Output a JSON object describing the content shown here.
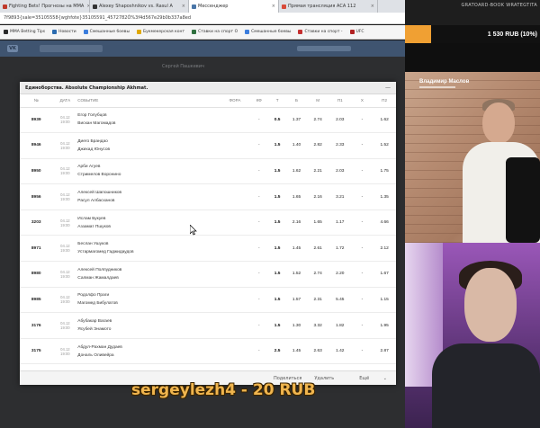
{
  "browser": {
    "tabs": [
      {
        "title": "Fighting Bets! Прогнозы на ММА",
        "color": "#c0392b",
        "active": false
      },
      {
        "title": "Alexey Shaposhnikov vs. Rasul A",
        "color": "#333333",
        "active": false
      },
      {
        "title": "Мессенджер",
        "color": "#4a76a8",
        "active": true
      },
      {
        "title": "Прямая трансляция ACA 112",
        "color": "#d84a3a",
        "active": false
      }
    ],
    "url": "7f9893{sale=35105558{wghfote}35105591_4572782Ó%3f4d567e29b0b337a8ed",
    "bookmarks": [
      {
        "label": "MMA Betting Tips",
        "color": "#2a2a2a"
      },
      {
        "label": "Новости",
        "color": "#2b6cb0"
      },
      {
        "label": "Смешанные боевы",
        "color": "#3b7ddd"
      },
      {
        "label": "Букмекерская конт",
        "color": "#e0a800"
      },
      {
        "label": "Ставки на спорт О",
        "color": "#2f6f3e"
      },
      {
        "label": "Смешанные боевы",
        "color": "#3b7ddd"
      },
      {
        "label": "Ставки на спорт -",
        "color": "#c53030"
      },
      {
        "label": "UFC",
        "color": "#b22222"
      }
    ]
  },
  "vk": {
    "logo": "VK",
    "page_strip": "Сергей Пашкевич"
  },
  "modal": {
    "title": "Единоборства. Absolute Championship Akhmat.",
    "columns": [
      "№",
      "ДАТА",
      "СОБЫТИЕ",
      "ФОРА",
      "КФ",
      "Т",
      "Б",
      "М",
      "П1",
      "Х",
      "П2"
    ],
    "rows": [
      {
        "num": "8939",
        "date": [
          "04.12",
          "19:00"
        ],
        "event": [
          "Егор Голубцов",
          "Вискан Магомадов"
        ],
        "fora": "",
        "kf": "-",
        "t": "0.5",
        "b": "1.37",
        "m": "2.74",
        "p1": "2.03",
        "x": "-",
        "p2": "1.62"
      },
      {
        "num": "8946",
        "date": [
          "04.12",
          "19:00"
        ],
        "event": [
          "Диего Брандао",
          "Джихад Юнусов"
        ],
        "fora": "",
        "kf": "-",
        "t": "1.5",
        "b": "1.40",
        "m": "2.82",
        "p1": "2.33",
        "x": "-",
        "p2": "1.52"
      },
      {
        "num": "8950",
        "date": [
          "04.12",
          "19:00"
        ],
        "event": [
          "Арби Агуев",
          "Стримелов Воронино"
        ],
        "fora": "",
        "kf": "-",
        "t": "1.5",
        "b": "1.62",
        "m": "2.21",
        "p1": "2.03",
        "x": "-",
        "p2": "1.75"
      },
      {
        "num": "8956",
        "date": [
          "04.12",
          "19:00"
        ],
        "event": [
          "Алексей Шапошников",
          "Расул Албасханов"
        ],
        "fora": "",
        "kf": "-",
        "t": "1.5",
        "b": "1.65",
        "m": "2.16",
        "p1": "3.21",
        "x": "-",
        "p2": "1.35"
      },
      {
        "num": "3203",
        "date": [
          "04.12",
          "19:00"
        ],
        "event": [
          "Ислам Букуев",
          "Аззамат Пшуков"
        ],
        "fora": "",
        "kf": "-",
        "t": "1.5",
        "b": "2.16",
        "m": "1.65",
        "p1": "1.17",
        "x": "-",
        "p2": "4.66"
      },
      {
        "num": "8971",
        "date": [
          "04.12",
          "19:00"
        ],
        "event": [
          "Беслан Ушуков",
          "Устармагомед Гаджидаудов"
        ],
        "fora": "",
        "kf": "-",
        "t": "1.5",
        "b": "1.45",
        "m": "2.61",
        "p1": "1.72",
        "x": "-",
        "p2": "2.12"
      },
      {
        "num": "8980",
        "date": [
          "04.12",
          "19:00"
        ],
        "event": [
          "Алексей Полпудников",
          "Салман Жамалдаев"
        ],
        "fora": "",
        "kf": "-",
        "t": "1.5",
        "b": "1.52",
        "m": "2.74",
        "p1": "2.20",
        "x": "-",
        "p2": "1.67"
      },
      {
        "num": "8985",
        "date": [
          "04.12",
          "19:00"
        ],
        "event": [
          "Родолфо Праги",
          "Магомед Бибулатов"
        ],
        "fora": "",
        "kf": "-",
        "t": "1.5",
        "b": "1.57",
        "m": "2.31",
        "p1": "5.45",
        "x": "-",
        "p2": "1.15"
      },
      {
        "num": "3176",
        "date": [
          "04.12",
          "19:00"
        ],
        "event": [
          "Абубакар Вагаев",
          "Ясубей Энамото"
        ],
        "fora": "",
        "kf": "-",
        "t": "1.5",
        "b": "1.30",
        "m": "3.32",
        "p1": "1.82",
        "x": "-",
        "p2": "1.95"
      },
      {
        "num": "3175",
        "date": [
          "04.12",
          "19:00"
        ],
        "event": [
          "Абдул-Рахман Дудаев",
          "Дональ Оливейра"
        ],
        "fora": "",
        "kf": "-",
        "t": "2.5",
        "b": "1.45",
        "m": "2.63",
        "p1": "1.42",
        "x": "-",
        "p2": "2.87"
      }
    ],
    "footer": {
      "share": "Поделиться",
      "delete": "Удалить",
      "more": "Ещё"
    }
  },
  "stream": {
    "top_text": "GRATOARD-BOOK WRATEGTITA",
    "goal_amount": "1 530 RUB (10%)",
    "goal_fill_fraction": 0.19,
    "streamer_name": "Владимир Маслов",
    "cam2_caption": "",
    "donation": "sergeylezh4 - 20 RUB",
    "accent": "#f0a033"
  }
}
